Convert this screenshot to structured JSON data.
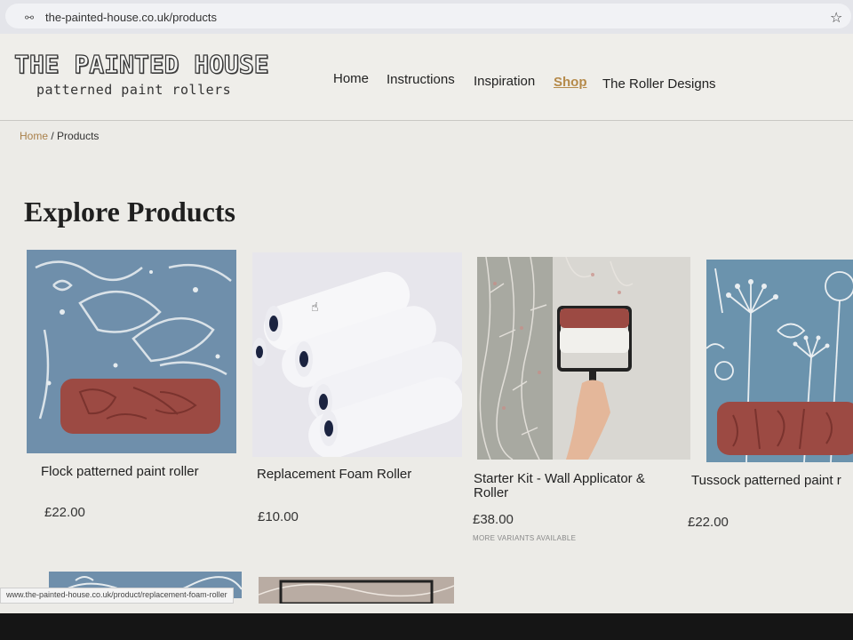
{
  "browser": {
    "url": "the-painted-house.co.uk/products",
    "status_url": "www.the-painted-house.co.uk/product/replacement-foam-roller",
    "icons": [
      "site-info-icon",
      "bookmark-star-icon"
    ]
  },
  "site": {
    "logo_title": "THE PAINTED HOUSE",
    "logo_subtitle": "patterned paint rollers",
    "nav": [
      {
        "label": "Home",
        "active": false
      },
      {
        "label": "Instructions",
        "active": false
      },
      {
        "label": "Inspiration",
        "active": false
      },
      {
        "label": "Shop",
        "active": true
      },
      {
        "label": "The Roller Designs",
        "active": false
      }
    ]
  },
  "breadcrumb": {
    "home": "Home",
    "separator": "/",
    "current": "Products"
  },
  "page": {
    "title": "Explore Products"
  },
  "products": [
    {
      "name": "Flock patterned paint roller",
      "price": "£22.00",
      "variants": ""
    },
    {
      "name": "Replacement Foam Roller",
      "price": "£10.00",
      "variants": ""
    },
    {
      "name": "Starter Kit - Wall Applicator &",
      "name_line2": "Roller",
      "price": "£38.00",
      "variants": "MORE VARIANTS AVAILABLE"
    },
    {
      "name": "Tussock patterned paint r",
      "price": "£22.00",
      "variants": ""
    }
  ],
  "colors": {
    "accent": "#b58a4a",
    "roller_red": "#9c4a43",
    "pattern_blue": "#6c8da9",
    "background": "#ecebe7"
  }
}
